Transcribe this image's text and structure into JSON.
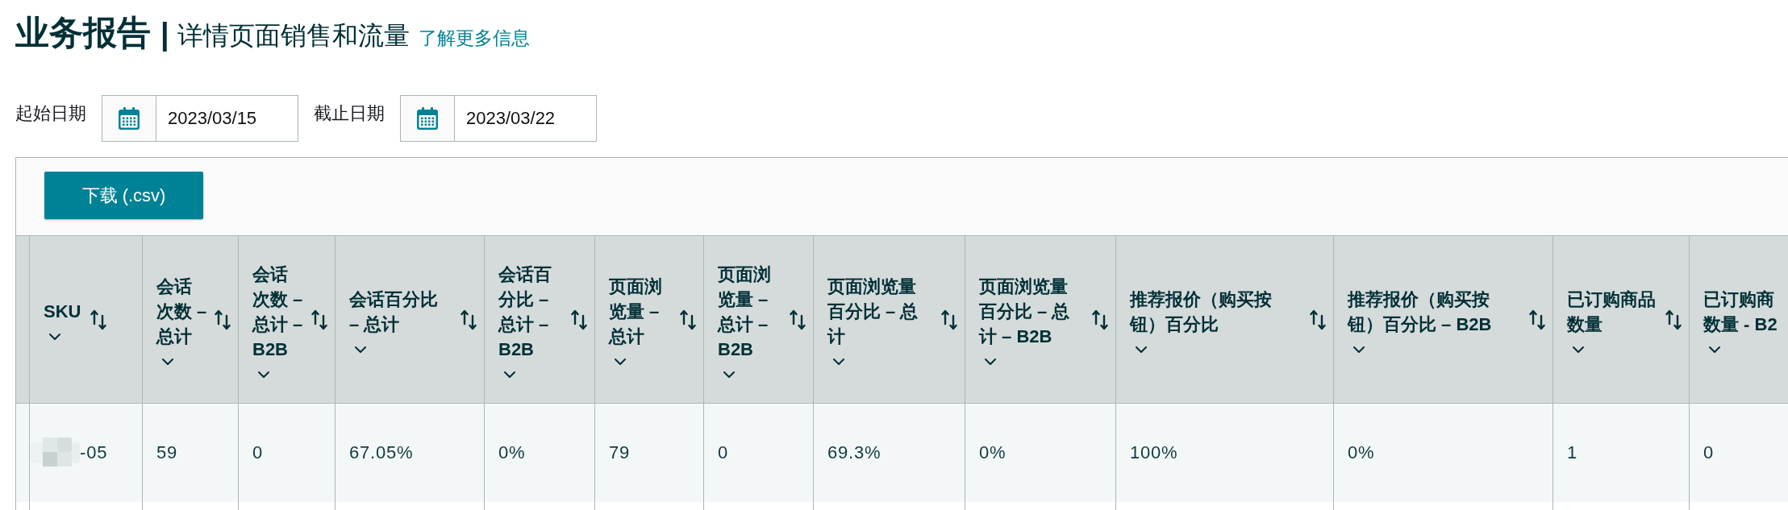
{
  "page_header": {
    "title": "业务报告",
    "separator": "|",
    "subtitle": "详情页面销售和流量",
    "help_link": "了解更多信息"
  },
  "date_filters": [
    {
      "label": "起始日期",
      "value": "2023/03/15"
    },
    {
      "label": "截止日期",
      "value": "2023/03/22"
    }
  ],
  "table": {
    "download_button": "下载 (.csv)",
    "columns": [
      {
        "label": "SKU",
        "sortable": true
      },
      {
        "label": "会话次数 – 总计",
        "sortable": true
      },
      {
        "label": "会话次数 – 总计 – B2B",
        "sortable": true
      },
      {
        "label": "会话百分比 – 总计",
        "sortable": true
      },
      {
        "label": "会话百分比 – 总计 – B2B",
        "sortable": true
      },
      {
        "label": "页面浏览量 – 总计",
        "sortable": true
      },
      {
        "label": "页面浏览量 – 总计 – B2B",
        "sortable": true
      },
      {
        "label": "页面浏览量百分比 – 总计",
        "sortable": true
      },
      {
        "label": "页面浏览量百分比 – 总计 – B2B",
        "sortable": true
      },
      {
        "label": "推荐报价（购买按钮）百分比",
        "sortable": true
      },
      {
        "label": "推荐报价（购买按钮）百分比 – B2B",
        "sortable": true
      },
      {
        "label": "已订购商品数量",
        "sortable": true
      },
      {
        "label": "已订购商数量 - B2",
        "sortable": false
      }
    ],
    "rows": [
      {
        "sku_redacted": true,
        "cells": [
          "-05",
          "59",
          "0",
          "67.05%",
          "0%",
          "79",
          "0",
          "69.3%",
          "0%",
          "100%",
          "0%",
          "1",
          "0"
        ]
      }
    ]
  }
}
